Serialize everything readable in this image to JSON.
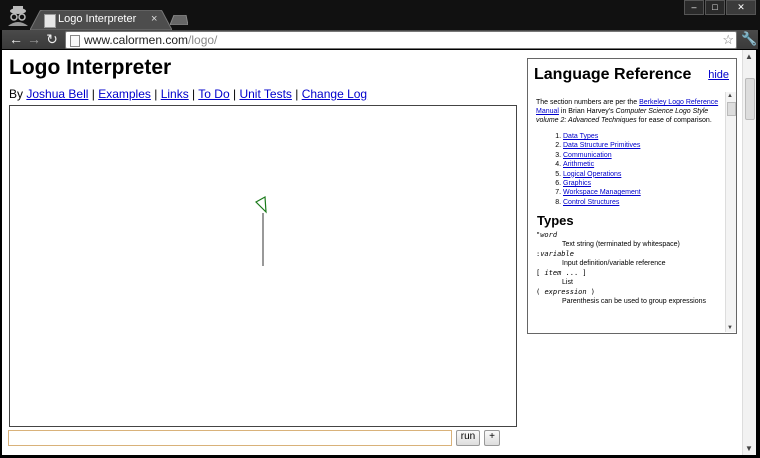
{
  "browser": {
    "tab_title": "Logo Interpreter",
    "tab_close": "×",
    "url_host": "www.calormen.com",
    "url_path": "/logo/",
    "window_controls": [
      "minimize-icon",
      "maximize-icon",
      "close-icon"
    ]
  },
  "page": {
    "title": "Logo Interpreter",
    "by_label": "By",
    "links": [
      {
        "label": "Joshua Bell"
      },
      {
        "label": "Examples"
      },
      {
        "label": "Links"
      },
      {
        "label": "To Do"
      },
      {
        "label": "Unit Tests"
      },
      {
        "label": "Change Log"
      }
    ],
    "separator": " | ",
    "command_value": "",
    "run_label": "run",
    "plus_label": "+"
  },
  "reference": {
    "title": "Language Reference",
    "hide_label": "hide",
    "intro_pre": "The section numbers are per the ",
    "intro_link": "Berkeley Logo Reference Manual",
    "intro_mid": " in Brian Harvey's ",
    "intro_book": "Computer Science Logo Style volume 2: Advanced Techniques",
    "intro_post": " for ease of comparison.",
    "sections": [
      "Data Types",
      "Data Structure Primitives",
      "Communication",
      "Arithmetic",
      "Logical Operations",
      "Graphics",
      "Workspace Management",
      "Control Structures"
    ],
    "types_heading": "Types",
    "types": [
      {
        "term_pre": "\"",
        "term_it": "word",
        "term_post": "",
        "desc": "Text string (terminated by whitespace)"
      },
      {
        "term_pre": ":",
        "term_it": "variable",
        "term_post": "",
        "desc": "Input definition/variable reference"
      },
      {
        "term_pre": "[ ",
        "term_it": "item",
        "term_post": " ... ]",
        "desc": "List"
      },
      {
        "term_pre": "( ",
        "term_it": "expression",
        "term_post": " )",
        "desc": "Parenthesis can be used to group expressions"
      }
    ]
  },
  "colors": {
    "turtle": "#1a7a1a",
    "line": "#333333",
    "link": "#0000cc"
  }
}
